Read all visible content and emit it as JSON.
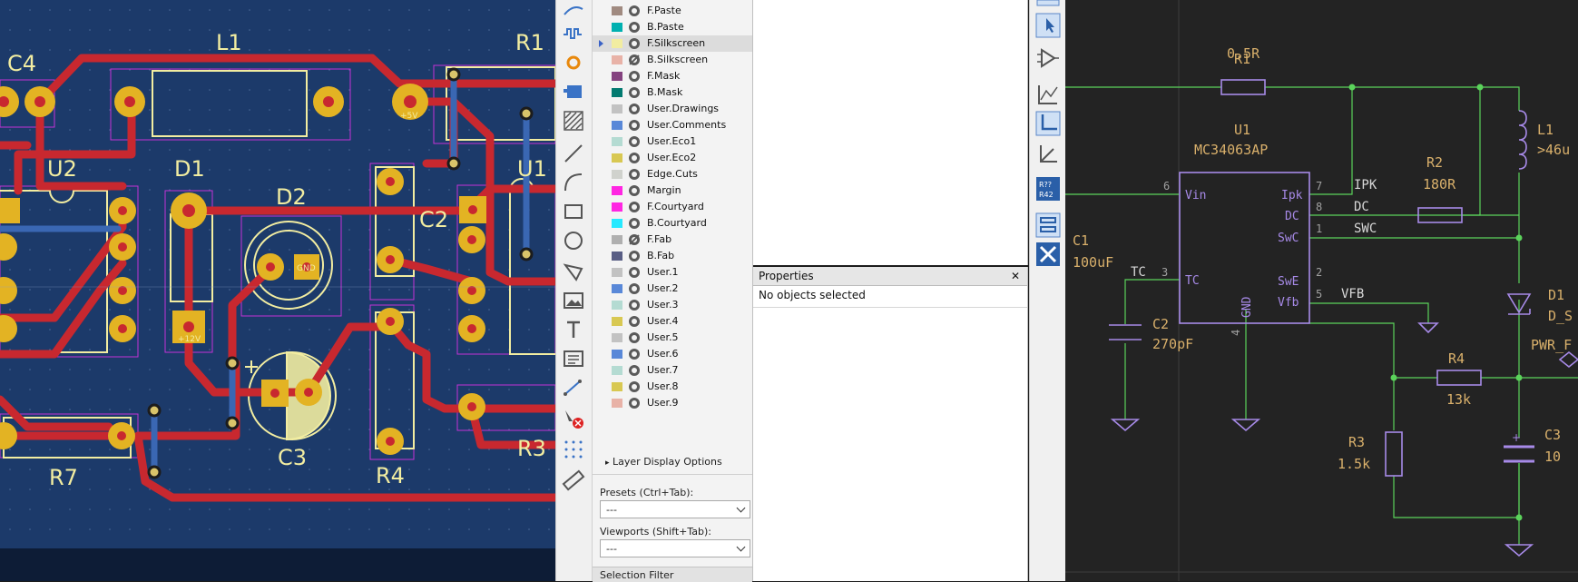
{
  "pcb": {
    "ref_c4": "C4",
    "ref_l1": "L1",
    "ref_r1": "R1",
    "ref_u2": "U2",
    "ref_d1": "D1",
    "ref_d2": "D2",
    "ref_c2": "C2",
    "ref_u1": "U1",
    "ref_c3": "C3",
    "ref_r4": "R4",
    "ref_r3": "R3",
    "ref_r7": "R7",
    "pad_plus5v": "+5V",
    "pad_plus12v": "+12V",
    "pad_gnd": "GND"
  },
  "layers": {
    "items": [
      {
        "name": "F.Paste",
        "color": "#a08a80",
        "visible": true
      },
      {
        "name": "B.Paste",
        "color": "#00b0b0",
        "visible": true
      },
      {
        "name": "F.Silkscreen",
        "color": "#f2eda1",
        "visible": true,
        "active": true
      },
      {
        "name": "B.Silkscreen",
        "color": "#e8b2a7",
        "visible": false
      },
      {
        "name": "F.Mask",
        "color": "#84427f",
        "visible": true
      },
      {
        "name": "B.Mask",
        "color": "#027a70",
        "visible": true
      },
      {
        "name": "User.Drawings",
        "color": "#c2c2c2",
        "visible": true
      },
      {
        "name": "User.Comments",
        "color": "#5988d8",
        "visible": true
      },
      {
        "name": "User.Eco1",
        "color": "#b4dbd2",
        "visible": true
      },
      {
        "name": "User.Eco2",
        "color": "#d8c852",
        "visible": true
      },
      {
        "name": "Edge.Cuts",
        "color": "#d0d2cd",
        "visible": true
      },
      {
        "name": "Margin",
        "color": "#ff26e2",
        "visible": true
      },
      {
        "name": "F.Courtyard",
        "color": "#ff26e2",
        "visible": true
      },
      {
        "name": "B.Courtyard",
        "color": "#26e9ff",
        "visible": true
      },
      {
        "name": "F.Fab",
        "color": "#afafaf",
        "visible": false
      },
      {
        "name": "B.Fab",
        "color": "#585d84",
        "visible": true
      },
      {
        "name": "User.1",
        "color": "#c2c2c2",
        "visible": true
      },
      {
        "name": "User.2",
        "color": "#5988d8",
        "visible": true
      },
      {
        "name": "User.3",
        "color": "#b4dbd2",
        "visible": true
      },
      {
        "name": "User.4",
        "color": "#d8c852",
        "visible": true
      },
      {
        "name": "User.5",
        "color": "#c2c2c2",
        "visible": true
      },
      {
        "name": "User.6",
        "color": "#5988d8",
        "visible": true
      },
      {
        "name": "User.7",
        "color": "#b4dbd2",
        "visible": true
      },
      {
        "name": "User.8",
        "color": "#d8c852",
        "visible": true
      },
      {
        "name": "User.9",
        "color": "#e8b2a7",
        "visible": true
      }
    ],
    "layer_display_options": "Layer Display Options",
    "presets_label": "Presets (Ctrl+Tab):",
    "presets_value": "---",
    "viewports_label": "Viewports (Shift+Tab):",
    "viewports_value": "---",
    "selection_filter": "Selection Filter"
  },
  "properties": {
    "title": "Properties",
    "close": "✕",
    "status": "No objects selected"
  },
  "schematic": {
    "r1_ref": "R1",
    "r1_val": "0.5R",
    "u1_ref": "U1",
    "u1_val": "MC34063AP",
    "l1_ref": "L1",
    "l1_val": ">46u",
    "r2_ref": "R2",
    "r2_val": "180R",
    "c1_ref": "C1",
    "c1_val": "100uF",
    "c2_ref": "C2",
    "c2_val": "270pF",
    "tc_label": "TC",
    "d1_ref": "D1",
    "d1_val": "D_S",
    "pwr_label": "PWR_F",
    "r4_ref": "R4",
    "r4_val": "13k",
    "r3_ref": "R3",
    "r3_val": "1.5k",
    "c3_ref": "C3",
    "c3_val": "10",
    "ipk_net": "IPK",
    "dc_net": "DC",
    "swc_net": "SWC",
    "vfb_net": "VFB",
    "pin_vin": "Vin",
    "pin_tc": "TC",
    "pin_ipk": "Ipk",
    "pin_dc": "DC",
    "pin_swc": "SwC",
    "pin_swe": "SwE",
    "pin_vfb": "Vfb",
    "pin_gnd": "GND",
    "pin6": "6",
    "pin3": "3",
    "pin7": "7",
    "pin8": "8",
    "pin1": "1",
    "pin2": "2",
    "pin5": "5",
    "pin4": "4"
  },
  "colors": {
    "track": "#c8282f",
    "pad": "#e3b323",
    "silk": "#f2eda1",
    "courtyard": "#c433d6",
    "board": "#1c3a6a",
    "wire": "#5bd35b",
    "symbol": "#a78ae8",
    "sch_text": "#d9b06b"
  }
}
